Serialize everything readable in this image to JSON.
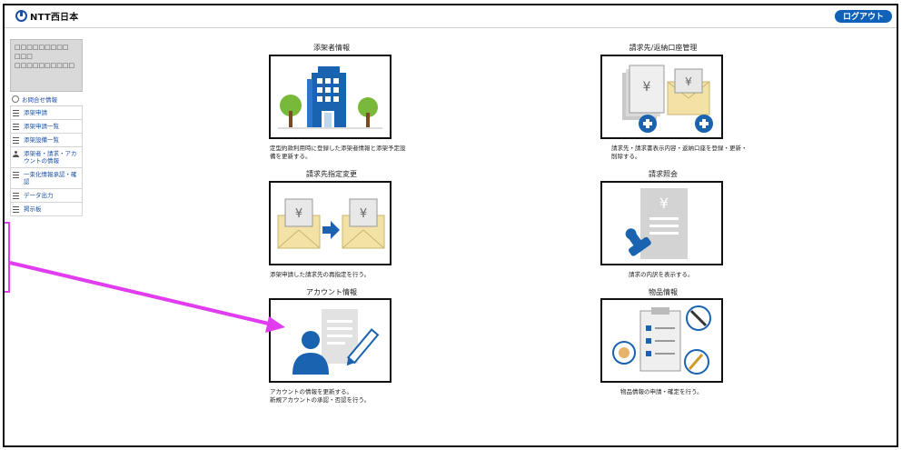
{
  "header": {
    "logo_text": "NTT西日本",
    "logout_label": "ログアウト"
  },
  "sidebar": {
    "user_lines": [
      "□□□□□□□□□",
      "□□□",
      "□□□□□□□□□□"
    ],
    "inquiry_label": "お問合せ情報",
    "items": [
      {
        "label": "添架申請",
        "icon": "list-icon"
      },
      {
        "label": "添架申請一覧",
        "icon": "list-icon"
      },
      {
        "label": "添架設備一覧",
        "icon": "list-icon"
      },
      {
        "label": "添架者・請求・アカウントの情報",
        "icon": "person-icon"
      },
      {
        "label": "一束化情報承認・確認",
        "icon": "list-icon"
      },
      {
        "label": "データ出力",
        "icon": "list-icon"
      },
      {
        "label": "掲示板",
        "icon": "list-icon"
      }
    ]
  },
  "cards": [
    {
      "title": "添架者情報",
      "desc": "定型約款利用時に登録した添架者情報と添架予定設備を更新する。",
      "icon": "building-icon"
    },
    {
      "title": "請求先/返納口座管理",
      "desc": "請求先・請求書表示内容・返納口座を登録・更新・削除する。",
      "icon": "documents-add-icon"
    },
    {
      "title": "請求先指定変更",
      "desc": "添架申請した請求先の再指定を行う。",
      "icon": "envelope-transfer-icon"
    },
    {
      "title": "請求照会",
      "desc": "請求の内訳を表示する。",
      "icon": "invoice-stamp-icon"
    },
    {
      "title": "アカウント情報",
      "desc": "アカウントの情報を更新する。\n新規アカウントの承認・否認を行う。",
      "icon": "account-edit-icon"
    },
    {
      "title": "物品情報",
      "desc": "物品情報の申請・確定を行う。",
      "icon": "equipment-checklist-icon"
    }
  ],
  "colors": {
    "accent": "#1161b9",
    "annotation": "#e13cf0",
    "tree_green": "#78b83a"
  }
}
